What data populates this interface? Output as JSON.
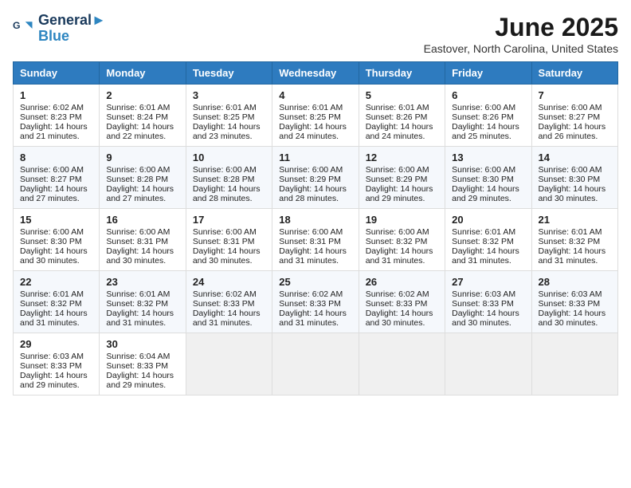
{
  "logo": {
    "line1": "General",
    "line2": "Blue"
  },
  "title": "June 2025",
  "subtitle": "Eastover, North Carolina, United States",
  "weekdays": [
    "Sunday",
    "Monday",
    "Tuesday",
    "Wednesday",
    "Thursday",
    "Friday",
    "Saturday"
  ],
  "weeks": [
    [
      {
        "day": "1",
        "sunrise": "6:02 AM",
        "sunset": "8:23 PM",
        "daylight": "14 hours and 21 minutes."
      },
      {
        "day": "2",
        "sunrise": "6:01 AM",
        "sunset": "8:24 PM",
        "daylight": "14 hours and 22 minutes."
      },
      {
        "day": "3",
        "sunrise": "6:01 AM",
        "sunset": "8:25 PM",
        "daylight": "14 hours and 23 minutes."
      },
      {
        "day": "4",
        "sunrise": "6:01 AM",
        "sunset": "8:25 PM",
        "daylight": "14 hours and 24 minutes."
      },
      {
        "day": "5",
        "sunrise": "6:01 AM",
        "sunset": "8:26 PM",
        "daylight": "14 hours and 24 minutes."
      },
      {
        "day": "6",
        "sunrise": "6:00 AM",
        "sunset": "8:26 PM",
        "daylight": "14 hours and 25 minutes."
      },
      {
        "day": "7",
        "sunrise": "6:00 AM",
        "sunset": "8:27 PM",
        "daylight": "14 hours and 26 minutes."
      }
    ],
    [
      {
        "day": "8",
        "sunrise": "6:00 AM",
        "sunset": "8:27 PM",
        "daylight": "14 hours and 27 minutes."
      },
      {
        "day": "9",
        "sunrise": "6:00 AM",
        "sunset": "8:28 PM",
        "daylight": "14 hours and 27 minutes."
      },
      {
        "day": "10",
        "sunrise": "6:00 AM",
        "sunset": "8:28 PM",
        "daylight": "14 hours and 28 minutes."
      },
      {
        "day": "11",
        "sunrise": "6:00 AM",
        "sunset": "8:29 PM",
        "daylight": "14 hours and 28 minutes."
      },
      {
        "day": "12",
        "sunrise": "6:00 AM",
        "sunset": "8:29 PM",
        "daylight": "14 hours and 29 minutes."
      },
      {
        "day": "13",
        "sunrise": "6:00 AM",
        "sunset": "8:30 PM",
        "daylight": "14 hours and 29 minutes."
      },
      {
        "day": "14",
        "sunrise": "6:00 AM",
        "sunset": "8:30 PM",
        "daylight": "14 hours and 30 minutes."
      }
    ],
    [
      {
        "day": "15",
        "sunrise": "6:00 AM",
        "sunset": "8:30 PM",
        "daylight": "14 hours and 30 minutes."
      },
      {
        "day": "16",
        "sunrise": "6:00 AM",
        "sunset": "8:31 PM",
        "daylight": "14 hours and 30 minutes."
      },
      {
        "day": "17",
        "sunrise": "6:00 AM",
        "sunset": "8:31 PM",
        "daylight": "14 hours and 30 minutes."
      },
      {
        "day": "18",
        "sunrise": "6:00 AM",
        "sunset": "8:31 PM",
        "daylight": "14 hours and 31 minutes."
      },
      {
        "day": "19",
        "sunrise": "6:00 AM",
        "sunset": "8:32 PM",
        "daylight": "14 hours and 31 minutes."
      },
      {
        "day": "20",
        "sunrise": "6:01 AM",
        "sunset": "8:32 PM",
        "daylight": "14 hours and 31 minutes."
      },
      {
        "day": "21",
        "sunrise": "6:01 AM",
        "sunset": "8:32 PM",
        "daylight": "14 hours and 31 minutes."
      }
    ],
    [
      {
        "day": "22",
        "sunrise": "6:01 AM",
        "sunset": "8:32 PM",
        "daylight": "14 hours and 31 minutes."
      },
      {
        "day": "23",
        "sunrise": "6:01 AM",
        "sunset": "8:32 PM",
        "daylight": "14 hours and 31 minutes."
      },
      {
        "day": "24",
        "sunrise": "6:02 AM",
        "sunset": "8:33 PM",
        "daylight": "14 hours and 31 minutes."
      },
      {
        "day": "25",
        "sunrise": "6:02 AM",
        "sunset": "8:33 PM",
        "daylight": "14 hours and 31 minutes."
      },
      {
        "day": "26",
        "sunrise": "6:02 AM",
        "sunset": "8:33 PM",
        "daylight": "14 hours and 30 minutes."
      },
      {
        "day": "27",
        "sunrise": "6:03 AM",
        "sunset": "8:33 PM",
        "daylight": "14 hours and 30 minutes."
      },
      {
        "day": "28",
        "sunrise": "6:03 AM",
        "sunset": "8:33 PM",
        "daylight": "14 hours and 30 minutes."
      }
    ],
    [
      {
        "day": "29",
        "sunrise": "6:03 AM",
        "sunset": "8:33 PM",
        "daylight": "14 hours and 29 minutes."
      },
      {
        "day": "30",
        "sunrise": "6:04 AM",
        "sunset": "8:33 PM",
        "daylight": "14 hours and 29 minutes."
      },
      null,
      null,
      null,
      null,
      null
    ]
  ],
  "labels": {
    "sunrise": "Sunrise:",
    "sunset": "Sunset:",
    "daylight": "Daylight:"
  }
}
